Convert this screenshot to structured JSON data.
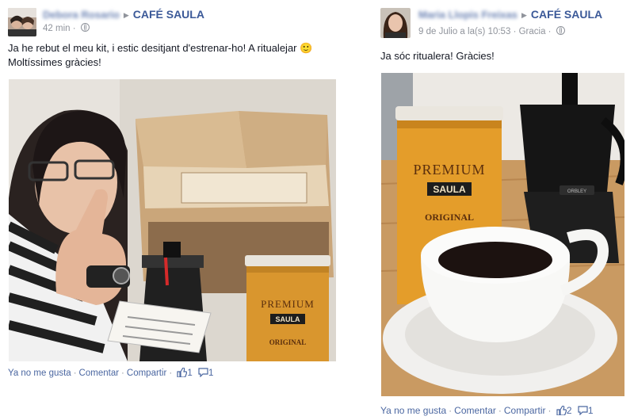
{
  "left_post": {
    "author_name": "Debora Rosario",
    "page_name": "CAFÉ SAULA",
    "timestamp": "42 min",
    "message": "Ja he rebut el meu kit, i estic desitjant d'estrenar-ho! A ritualejar 🙂 Moltíssimes gràcies!",
    "photo": {
      "tin_label_top": "PREMIUM",
      "tin_label_brand": "SAULA",
      "tin_label_bottom": "ORIGINAL"
    },
    "actions": {
      "unlike": "Ya no me gusta",
      "comment": "Comentar",
      "share": "Compartir",
      "like_count": "1",
      "comment_count": "1"
    }
  },
  "right_post": {
    "author_name": "Maria Llopis Freixas",
    "page_name": "CAFÉ SAULA",
    "timestamp": "9 de Julio a la(s) 10:53",
    "location": "Gracia",
    "message": "Ja sóc ritualera! Gràcies!",
    "photo": {
      "tin_label_top": "PREMIUM",
      "tin_label_brand": "SAULA",
      "tin_label_bottom": "ORIGINAL",
      "pot_brand": "ORBLEY"
    },
    "actions": {
      "unlike": "Ya no me gusta",
      "comment": "Comentar",
      "share": "Compartir",
      "like_count": "2",
      "comment_count": "1"
    }
  },
  "colors": {
    "link": "#3b5998",
    "meta": "#90949c",
    "text": "#141823"
  }
}
